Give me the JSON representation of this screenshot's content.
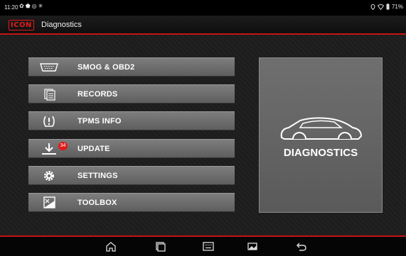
{
  "status_bar": {
    "time": "11:20",
    "left_icons": [
      "settings-icon",
      "shield-icon",
      "at-icon",
      "wifi-small-icon"
    ],
    "battery": "71%"
  },
  "header": {
    "logo_text": "ICON",
    "title": "Diagnostics"
  },
  "menu": [
    {
      "label": "SMOG & OBD2",
      "icon": "obd-connector-icon"
    },
    {
      "label": "RECORDS",
      "icon": "records-icon"
    },
    {
      "label": "TPMS INFO",
      "icon": "tpms-icon"
    },
    {
      "label": "UPDATE",
      "icon": "download-icon",
      "badge": "34"
    },
    {
      "label": "SETTINGS",
      "icon": "gear-icon"
    },
    {
      "label": "TOOLBOX",
      "icon": "toolbox-icon"
    }
  ],
  "diagnostics_panel": {
    "label": "DIAGNOSTICS",
    "icon": "car-icon"
  },
  "nav_bar": [
    "home-icon",
    "recent-apps-icon",
    "keyboard-icon",
    "screenshot-icon",
    "back-icon"
  ],
  "colors": {
    "accent": "#c61414",
    "button_gray": "#6e6e6e",
    "badge": "#e01b1b"
  }
}
